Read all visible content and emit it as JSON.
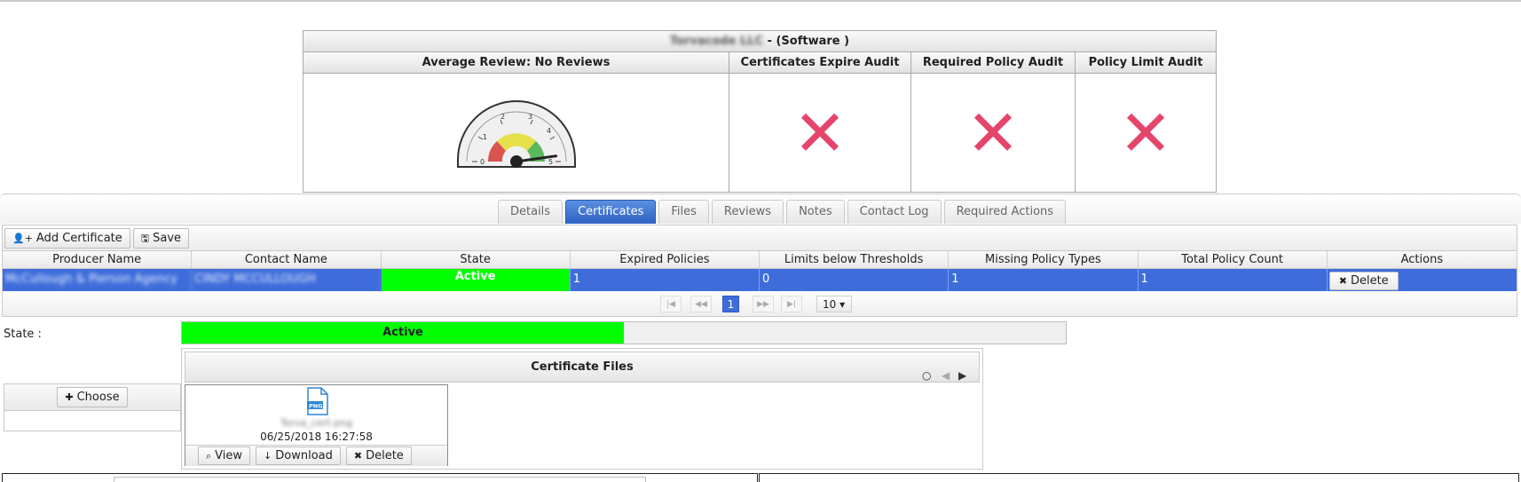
{
  "summary": {
    "company_name": "Torvacode LLC",
    "company_suffix": " - (Software )",
    "columns": [
      {
        "title": "Average Review: No Reviews",
        "widget": "gauge",
        "gauge_value": 4.6,
        "gauge_ticks": [
          "0",
          "1",
          "2",
          "3",
          "4",
          "5"
        ]
      },
      {
        "title": "Certificates Expire Audit",
        "mark": "✕"
      },
      {
        "title": "Required Policy Audit",
        "mark": "✕"
      },
      {
        "title": "Policy Limit Audit",
        "mark": "✕"
      }
    ]
  },
  "tabs": [
    "Details",
    "Certificates",
    "Files",
    "Reviews",
    "Notes",
    "Contact Log",
    "Required Actions"
  ],
  "active_tab": "Certificates",
  "toolbar": {
    "add_label": "Add Certificate",
    "save_label": "Save"
  },
  "grid": {
    "headers": [
      "Producer Name",
      "Contact Name",
      "State",
      "Expired Policies",
      "Limits below Thresholds",
      "Missing Policy Types",
      "Total Policy Count",
      "Actions"
    ],
    "row": {
      "producer": "McCullough & Pierson Agency",
      "contact": "CINDY MCCULLOUGH",
      "state": "Active",
      "expired": "1",
      "limits": "0",
      "missing": "1",
      "total": "1",
      "delete_label": "Delete"
    }
  },
  "pager": {
    "first": "|◀",
    "prev": "◀◀",
    "current": "1",
    "next": "▶▶",
    "last": "▶|",
    "page_size": "10 ▾"
  },
  "state_row": {
    "label": "State :",
    "value": "Active",
    "progress": 0.5,
    "color": "#00ff00"
  },
  "choose_label": "Choose",
  "files": {
    "title": "Certificate Files",
    "item": {
      "name": "Torva_cert.png",
      "type_badge": "PNG",
      "date": "06/25/2018 16:27:58",
      "view": "View",
      "download": "Download",
      "delete": "Delete"
    }
  }
}
